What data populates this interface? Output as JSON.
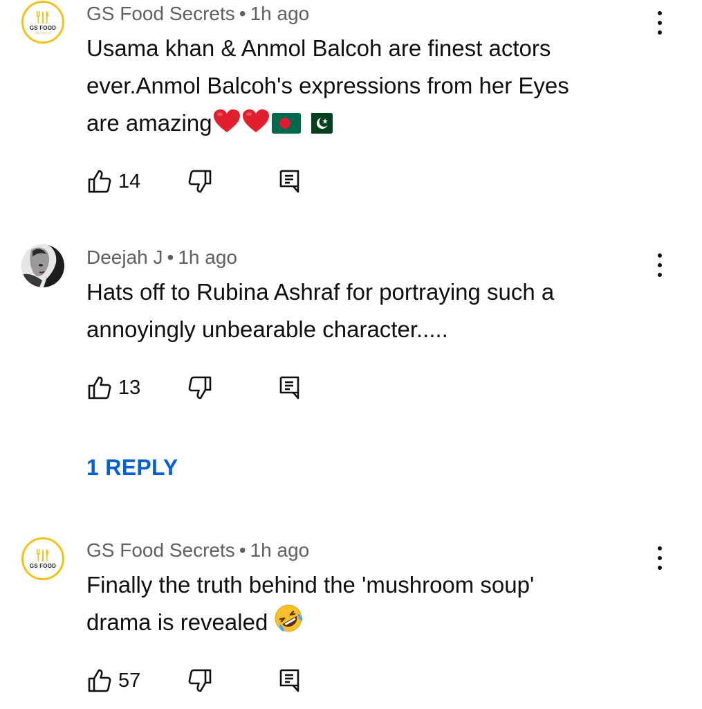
{
  "comments": [
    {
      "author": "GS Food Secrets",
      "separator": "•",
      "time": "1h ago",
      "avatar_text": "GS FOOD",
      "avatar_subtext": "SECRETS",
      "lines": [
        "Usama khan & Anmol Balcoh are finest actors",
        "ever.Anmol Balcoh's expressions from her Eyes",
        "are amazing"
      ],
      "emoji_trail": [
        "red-heart",
        "red-heart",
        "flag-bangladesh",
        "flag-pakistan"
      ],
      "likes": "14"
    },
    {
      "author": "Deejah J",
      "separator": "•",
      "time": "1h ago",
      "lines": [
        "Hats off to Rubina Ashraf for portraying such a",
        "annoyingly unbearable character....."
      ],
      "likes": "13",
      "reply_label": "1 REPLY"
    },
    {
      "author": "GS Food Secrets",
      "separator": "•",
      "time": "1h ago",
      "avatar_text": "GS FOOD",
      "lines": [
        "Finally the truth behind the 'mushroom soup'",
        "drama is revealed"
      ],
      "emoji_trail": [
        "rolling-on-floor-laughing"
      ],
      "likes": "57"
    }
  ],
  "colors": {
    "text": "#0f0f0f",
    "meta": "#606060",
    "link": "#065fd4",
    "avatar_ring": "#f2c21b"
  },
  "icons": {
    "like": "thumbs-up-icon",
    "dislike": "thumbs-down-icon",
    "reply": "reply-comment-icon",
    "more": "more-vertical-icon"
  }
}
